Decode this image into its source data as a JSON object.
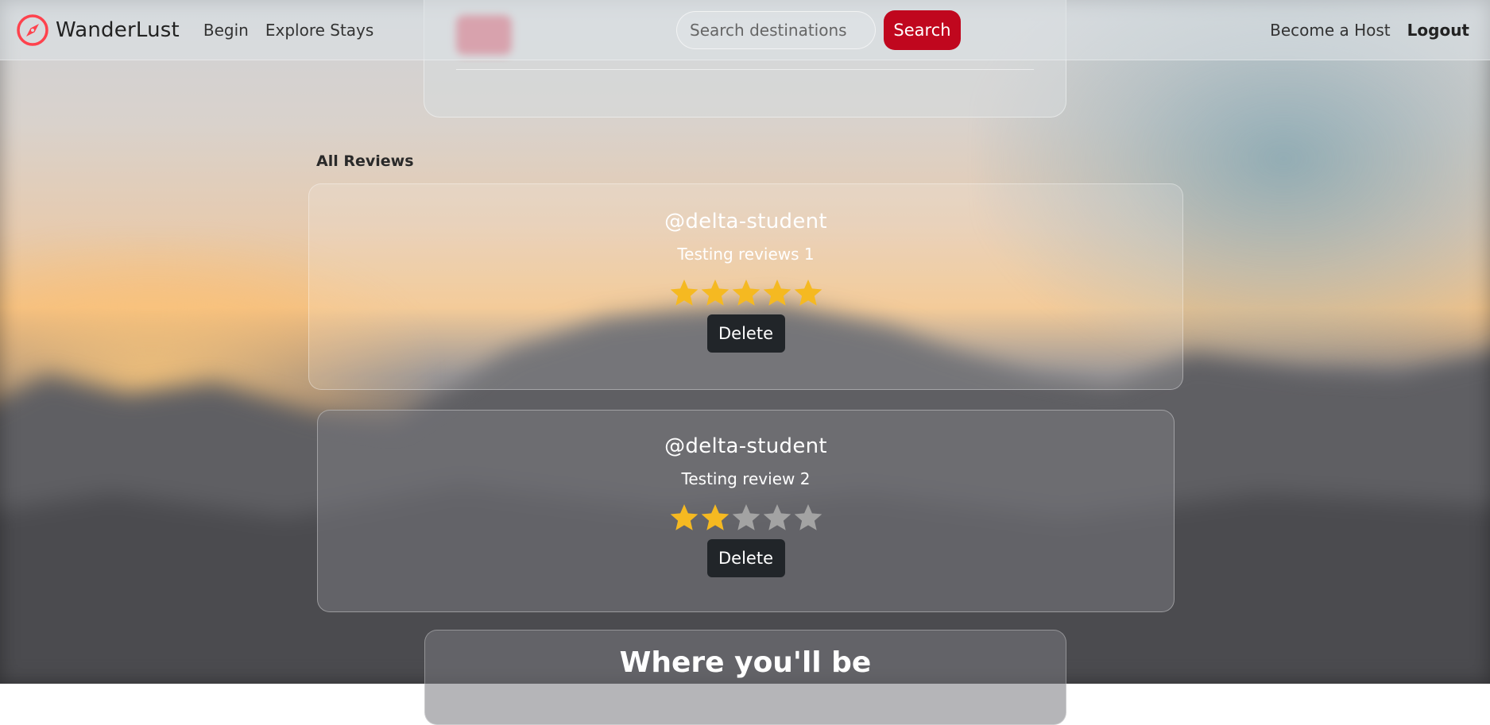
{
  "navbar": {
    "brand": "WanderLust",
    "links": [
      "Begin",
      "Explore Stays"
    ],
    "search_placeholder": "Search destinations",
    "search_button": "Search",
    "become_host": "Become a Host",
    "logout": "Logout"
  },
  "reviews": {
    "heading": "All Reviews",
    "items": [
      {
        "author": "@delta-student",
        "comment": "Testing reviews 1",
        "rating": 5,
        "delete_label": "Delete"
      },
      {
        "author": "@delta-student",
        "comment": "Testing review 2",
        "rating": 2,
        "delete_label": "Delete"
      }
    ],
    "max_rating": 5
  },
  "map": {
    "heading": "Where you'll be"
  },
  "colors": {
    "brand_red": "#c0071e",
    "logo_red": "#fe424d",
    "star_filled": "#f5b921",
    "star_empty": "#a3a3a3",
    "button_dark": "#212529"
  },
  "icons": {
    "logo": "compass-icon",
    "star": "star-icon"
  }
}
